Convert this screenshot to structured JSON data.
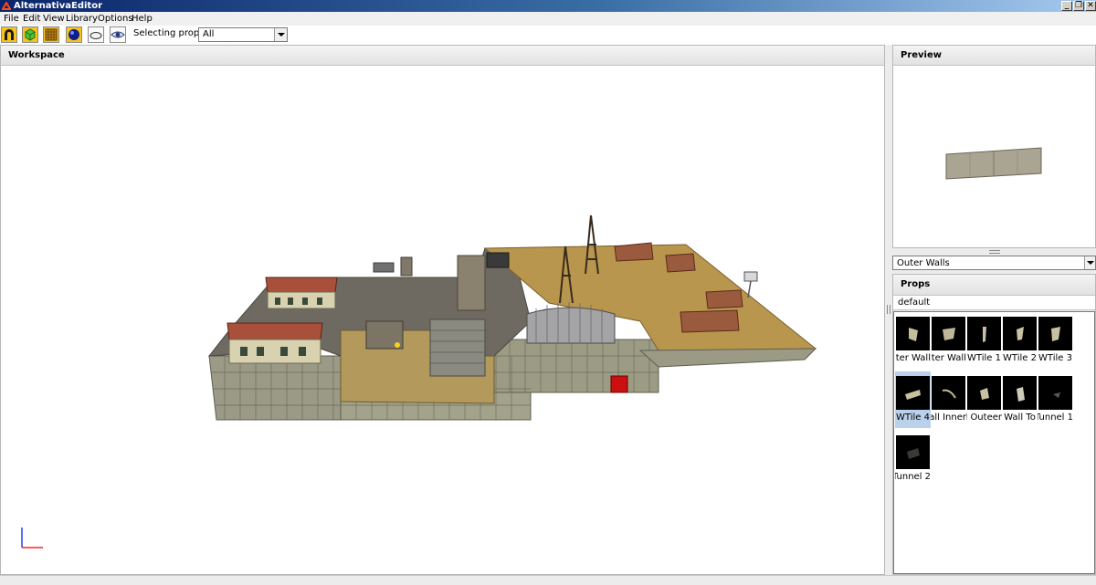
{
  "window": {
    "title": "AlternativaEditor",
    "controls": [
      "_",
      "❐",
      "✕"
    ]
  },
  "menu": [
    "File",
    "Edit",
    "View",
    "Library",
    "Options",
    "Help"
  ],
  "toolbar": {
    "tools": [
      "magnet-icon",
      "cube-icon",
      "grid-icon",
      "sphere-icon",
      "plane-icon",
      "eye-icon"
    ],
    "selecting_label": "Selecting prop:",
    "selecting_value": "All"
  },
  "workspace": {
    "title": "Workspace"
  },
  "preview": {
    "title": "Preview"
  },
  "library": {
    "selected": "Outer Walls"
  },
  "props": {
    "title": "Props",
    "group": "default",
    "items": [
      "Outer Wall",
      "Outer Wall",
      "WTile 1",
      "WTile 2",
      "WTile 3",
      "WTile 4",
      "Wall Inner",
      "Wall Outeer",
      "Wall To",
      "Tunnel 1",
      "Tunnel 2"
    ],
    "selected_index": 5
  },
  "colors": {
    "accent": "#0a246a",
    "selection": "#b9d1ea"
  }
}
